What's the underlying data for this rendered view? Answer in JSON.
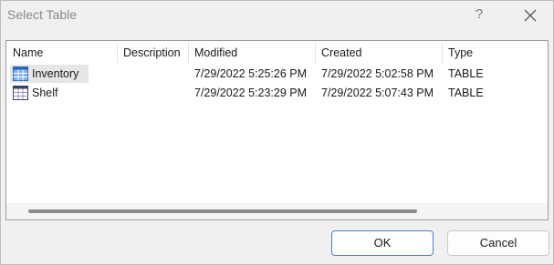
{
  "window": {
    "title": "Select Table",
    "help_glyph": "?"
  },
  "table": {
    "columns": [
      "Name",
      "Description",
      "Modified",
      "Created",
      "Type"
    ],
    "rows": [
      {
        "name": "Inventory",
        "description": "",
        "modified": "7/29/2022 5:25:26 PM",
        "created": "7/29/2022 5:02:58 PM",
        "type": "TABLE",
        "icon": "table-icon",
        "selected": true
      },
      {
        "name": "Shelf",
        "description": "",
        "modified": "7/29/2022 5:23:29 PM",
        "created": "7/29/2022 5:07:43 PM",
        "type": "TABLE",
        "icon": "table-icon",
        "selected": false
      }
    ]
  },
  "buttons": {
    "ok_label": "OK",
    "cancel_label": "Cancel"
  },
  "colors": {
    "background": "#f0f0f0",
    "list_background": "#ffffff",
    "selection": "#e6e6e6",
    "primary_border": "#4a7fc8",
    "icon_blue": "#3d7ad6"
  }
}
